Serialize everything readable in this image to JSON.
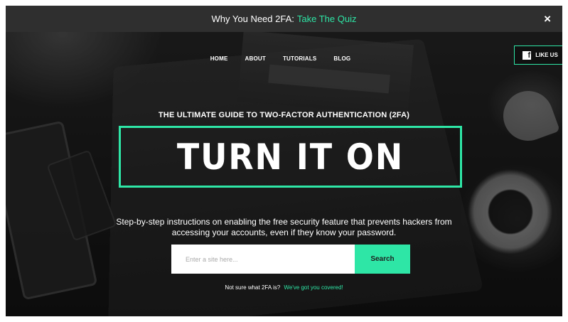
{
  "banner": {
    "text": "Why You Need 2FA:",
    "link": "Take The Quiz",
    "close": "×"
  },
  "nav": {
    "items": [
      "HOME",
      "ABOUT",
      "TUTORIALS",
      "BLOG"
    ]
  },
  "like": {
    "icon": "facebook-icon",
    "label": "LIKE US"
  },
  "hero": {
    "subtitle": "THE ULTIMATE GUIDE TO TWO-FACTOR AUTHENTICATION (2FA)",
    "title": "TURN IT ON",
    "desc_line1": "Step-by-step instructions on enabling the free security feature that prevents hackers from",
    "desc_line2": "accessing your accounts, even if they know your password."
  },
  "search": {
    "placeholder": "Enter a site here...",
    "button": "Search"
  },
  "note": {
    "text": "Not sure what 2FA is?",
    "link": "We've got you covered!"
  },
  "colors": {
    "accent": "#2ee6a6",
    "banner_bg": "#2f2f2f"
  }
}
